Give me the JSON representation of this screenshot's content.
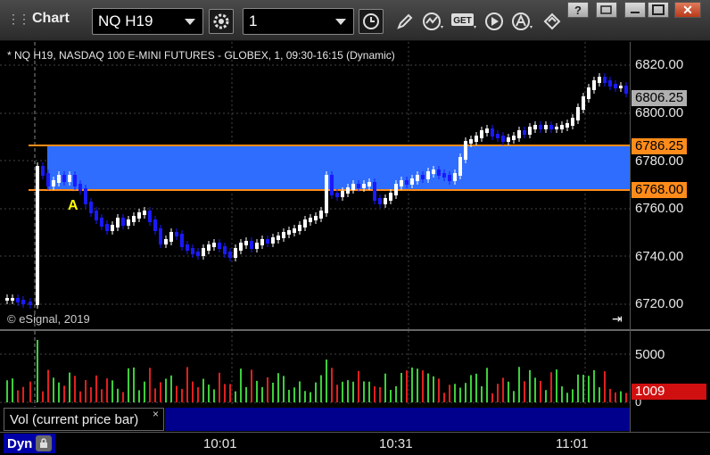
{
  "window": {
    "title": "Chart",
    "minimize_label": "",
    "restore_label": "",
    "maximize_label": "",
    "close_label": ""
  },
  "toolbar": {
    "symbol": "NQ H19",
    "interval": "1",
    "icons": [
      "settings-gear-icon",
      "clock-icon",
      "pencil-icon",
      "study-wave-icon",
      "get-data-icon",
      "play-icon",
      "alert-icon",
      "link-icon"
    ],
    "get_label": "GET"
  },
  "chart": {
    "caption": "* NQ H19, NASDAQ 100 E-MINI FUTURES - GLOBEX, 1, 09:30-16:15 (Dynamic)",
    "copyright": "© eSignal, 2019",
    "annotation": "A",
    "price_axis": [
      "6820.00",
      "6800.00",
      "6780.00",
      "6760.00",
      "6740.00",
      "6720.00"
    ],
    "current_price": "6806.25",
    "zone_top_price": "6786.25",
    "zone_bottom_price": "6768.00",
    "volume_axis": [
      "5000",
      "0"
    ],
    "current_volume": "1009",
    "volume_legend": "Vol (current price bar)",
    "volume_legend_close": "×",
    "time_axis": [
      "10:01",
      "10:31",
      "11:01"
    ],
    "dyn_label": "Dyn",
    "colors": {
      "zone": "#2f6dff",
      "zone_border": "#ff8c1a",
      "up_bar": "#ffffff",
      "down_bar": "#1a1aff",
      "vol_up": "#3cd03c",
      "vol_down": "#e02020",
      "current_price_tag": "#b0b0b0",
      "volume_tag": "#d01010"
    }
  }
}
